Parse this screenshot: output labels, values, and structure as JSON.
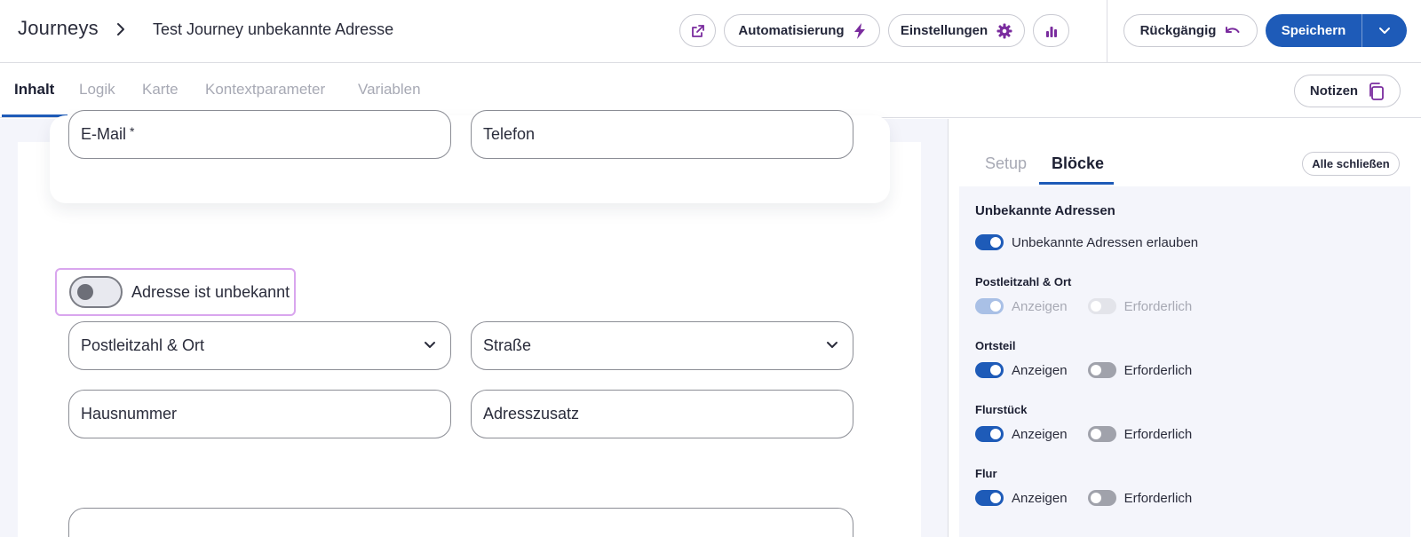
{
  "header": {
    "brand": "Journeys",
    "journey_name": "Test Journey unbekannte Adresse",
    "automation_label": "Automatisierung",
    "settings_label": "Einstellungen",
    "undo_label": "Rückgängig",
    "save_label": "Speichern"
  },
  "tabs": [
    {
      "label": "Inhalt",
      "active": true
    },
    {
      "label": "Logik",
      "active": false
    },
    {
      "label": "Karte",
      "active": false
    },
    {
      "label": "Kontextparameter",
      "active": false
    },
    {
      "label": "Variablen",
      "active": false
    }
  ],
  "notes_label": "Notizen",
  "form": {
    "email_label": "E-Mail",
    "email_required": "*",
    "phone_label": "Telefon",
    "unknown_toggle_label": "Adresse ist unbekannt",
    "unknown_toggle_on": false,
    "zip_city_label": "Postleitzahl & Ort",
    "street_label": "Straße",
    "house_number_label": "Hausnummer",
    "address_addition_label": "Adresszusatz"
  },
  "panel": {
    "tabs": [
      {
        "label": "Setup",
        "active": false
      },
      {
        "label": "Blöcke",
        "active": true
      }
    ],
    "close_all_label": "Alle schließen",
    "block_title": "Unbekannte Adressen",
    "allow_label": "Unbekannte Adressen erlauben",
    "allow_on": true,
    "sections": [
      {
        "label": "Postleitzahl & Ort",
        "show": "Anzeigen",
        "required": "Erforderlich",
        "show_on": true,
        "required_on": false,
        "disabled": true
      },
      {
        "label": "Ortsteil",
        "show": "Anzeigen",
        "required": "Erforderlich",
        "show_on": true,
        "required_on": false,
        "disabled": false
      },
      {
        "label": "Flurstück",
        "show": "Anzeigen",
        "required": "Erforderlich",
        "show_on": true,
        "required_on": false,
        "disabled": false
      },
      {
        "label": "Flur",
        "show": "Anzeigen",
        "required": "Erforderlich",
        "show_on": true,
        "required_on": false,
        "disabled": false
      }
    ]
  },
  "colors": {
    "primary": "#1e5bb8",
    "accent_purple": "#7a2c9e",
    "focus_outline": "#d9a6ee"
  }
}
